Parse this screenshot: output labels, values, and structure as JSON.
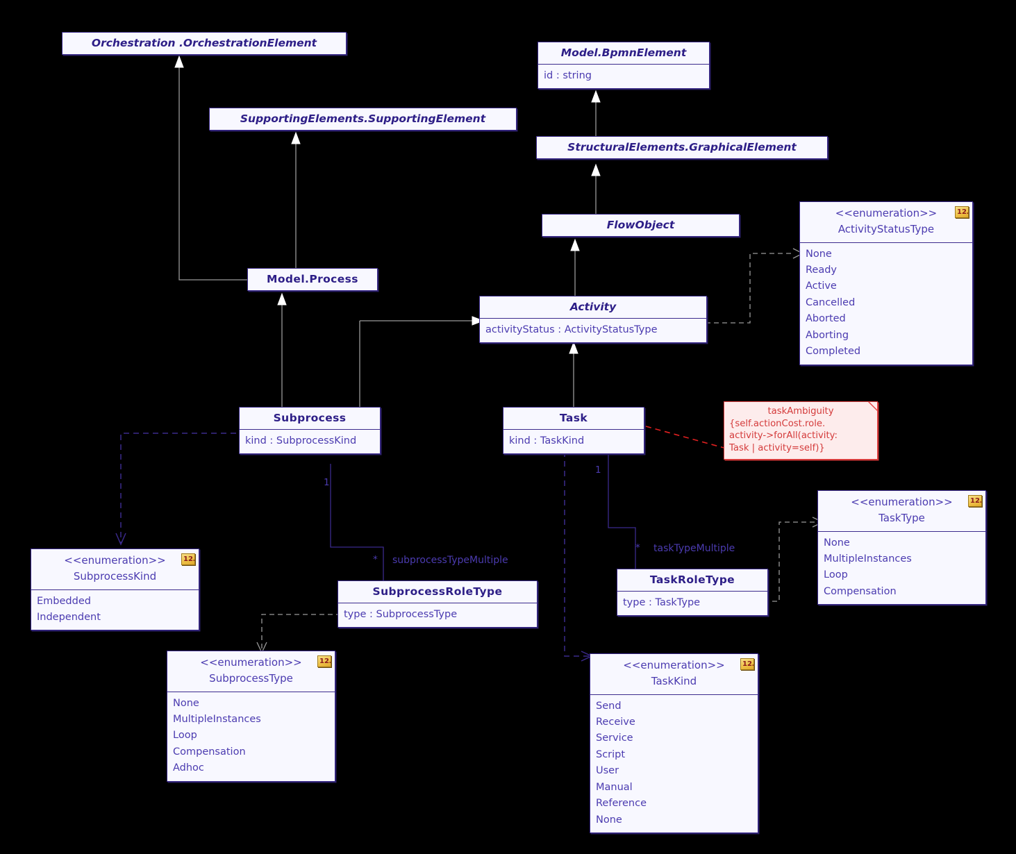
{
  "diagram": {
    "title": "BPMN Activity / Task UML class diagram",
    "colors": {
      "background": "#000000",
      "box_fill": "#f8f8ff",
      "box_stroke": "#3b2a8c",
      "text": "#2d1e87",
      "attribute_text": "#4b3bb0",
      "note_fill": "#fdecec",
      "note_stroke": "#e24444",
      "note_text": "#d43b3b",
      "generalization_line": "#9a9a9a",
      "dependency_gray": "#9a9a9a",
      "dependency_purple": "#3b2a8c",
      "constraint_line": "#e02020",
      "enum_badge": "#efc34a"
    }
  },
  "classes": {
    "orchestration_element": {
      "name": "Orchestration .OrchestrationElement",
      "abstract": true
    },
    "supporting_element": {
      "name": "SupportingElements.SupportingElement",
      "abstract": true
    },
    "bpmn_element": {
      "name": "Model.BpmnElement",
      "abstract": true,
      "attributes": [
        "id : string"
      ]
    },
    "graphical_element": {
      "name": "StructuralElements.GraphicalElement",
      "abstract": true
    },
    "flow_object": {
      "name": "FlowObject",
      "abstract": true
    },
    "model_process": {
      "name": "Model.Process",
      "abstract": false
    },
    "activity": {
      "name": "Activity",
      "abstract": true,
      "attributes": [
        "activityStatus : ActivityStatusType"
      ]
    },
    "subprocess": {
      "name": "Subprocess",
      "abstract": false,
      "attributes": [
        "kind : SubprocessKind"
      ]
    },
    "task": {
      "name": "Task",
      "abstract": false,
      "attributes": [
        "kind : TaskKind"
      ]
    },
    "subprocess_role_type": {
      "name": "SubprocessRoleType",
      "abstract": false,
      "attributes": [
        "type : SubprocessType"
      ]
    },
    "task_role_type": {
      "name": "TaskRoleType",
      "abstract": false,
      "attributes": [
        "type : TaskType"
      ]
    }
  },
  "enumerations": {
    "stereotype": "<<enumeration>>",
    "badge_label": "12…",
    "activity_status_type": {
      "name": "ActivityStatusType",
      "literals": [
        "None",
        "Ready",
        "Active",
        "Cancelled",
        "Aborted",
        "Aborting",
        "Completed"
      ]
    },
    "subprocess_kind": {
      "name": "SubprocessKind",
      "literals": [
        "Embedded",
        "Independent"
      ]
    },
    "subprocess_type": {
      "name": "SubprocessType",
      "literals": [
        "None",
        "MultipleInstances",
        "Loop",
        "Compensation",
        "Adhoc"
      ]
    },
    "task_kind": {
      "name": "TaskKind",
      "literals": [
        "Send",
        "Receive",
        "Service",
        "Script",
        "User",
        "Manual",
        "Reference",
        "None"
      ]
    },
    "task_type": {
      "name": "TaskType",
      "literals": [
        "None",
        "MultipleInstances",
        "Loop",
        "Compensation"
      ]
    }
  },
  "note": {
    "title": "taskAmbiguity",
    "lines": [
      "{self.actionCost.role.",
      "activity->forAll(activity:",
      "Task | activity=self)}"
    ]
  },
  "associations": {
    "subprocess_role": {
      "source_multiplicity": "1",
      "target_multiplicity": "*",
      "role_name": "subprocessTypeMultiple"
    },
    "task_role": {
      "source_multiplicity": "1",
      "target_multiplicity": "*",
      "role_name": "taskTypeMultiple"
    }
  }
}
